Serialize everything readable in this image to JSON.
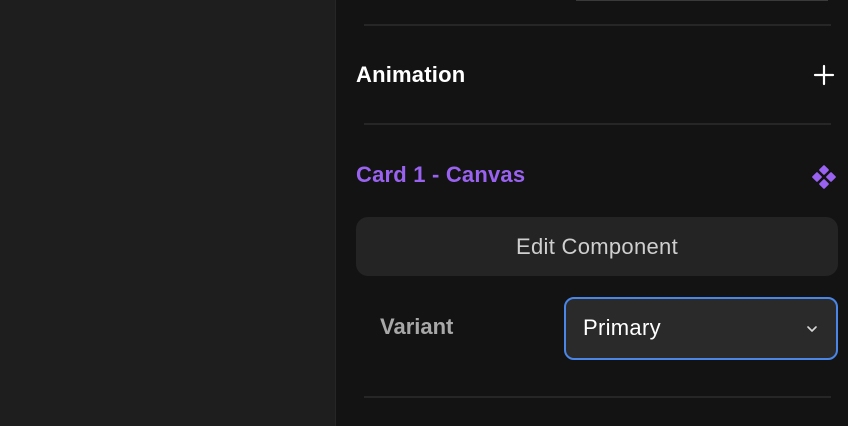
{
  "sections": {
    "animation": {
      "title": "Animation",
      "add_icon": "plus-icon"
    },
    "component": {
      "title": "Card 1 - Canvas",
      "title_color": "#9a62f0",
      "icon": "component-icon",
      "edit_button_label": "Edit Component",
      "variant": {
        "label": "Variant",
        "selected": "Primary",
        "icon": "chevron-down-icon"
      }
    }
  },
  "colors": {
    "panel_bg": "#131313",
    "canvas_bg": "#1e1e1e",
    "accent_purple": "#9a62f0",
    "focus_blue": "#4a86e8"
  }
}
